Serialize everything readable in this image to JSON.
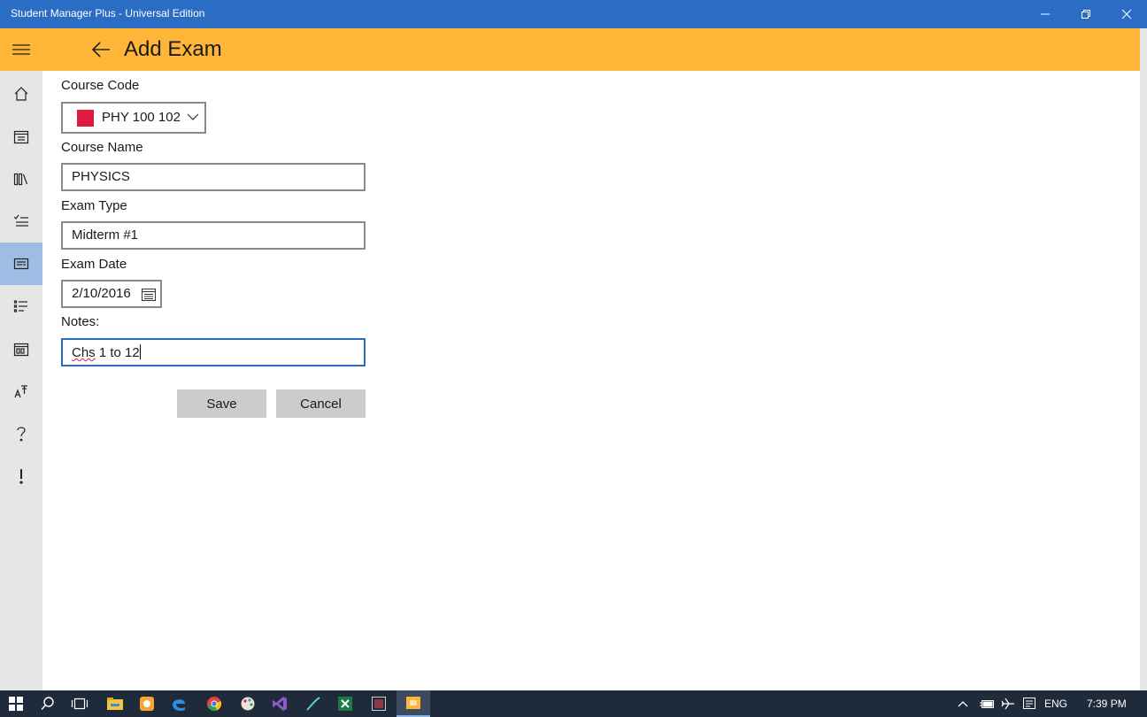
{
  "window": {
    "title": "Student Manager Plus - Universal Edition"
  },
  "header": {
    "title": "Add Exam"
  },
  "sidebar": {
    "items": [
      {
        "icon": "home-icon"
      },
      {
        "icon": "calendar-icon"
      },
      {
        "icon": "library-icon"
      },
      {
        "icon": "checklist-icon"
      },
      {
        "icon": "exam-card-icon",
        "active": true
      },
      {
        "icon": "bulleted-list-icon"
      },
      {
        "icon": "schedule-icon"
      },
      {
        "icon": "font-size-icon"
      },
      {
        "icon": "help-icon"
      },
      {
        "icon": "exclamation-icon"
      }
    ]
  },
  "form": {
    "course_code_label": "Course Code",
    "course_code_value": "PHY 100 102",
    "course_color": "#e0193f",
    "course_name_label": "Course Name",
    "course_name_value": "PHYSICS",
    "exam_type_label": "Exam Type",
    "exam_type_value": "Midterm #1",
    "exam_date_label": "Exam Date",
    "exam_date_value": "2/10/2016",
    "notes_label": "Notes:",
    "notes_value_misspelled": "Chs",
    "notes_value_rest": " 1 to 12",
    "save_label": "Save",
    "cancel_label": "Cancel"
  },
  "taskbar": {
    "language": "ENG",
    "time": "7:39 PM"
  },
  "colors": {
    "titlebar": "#2b6cc4",
    "header": "#ffb638",
    "sidebar": "#e6e6e6",
    "sidebar_active": "#9fbde4",
    "taskbar": "#1f2a3a"
  }
}
